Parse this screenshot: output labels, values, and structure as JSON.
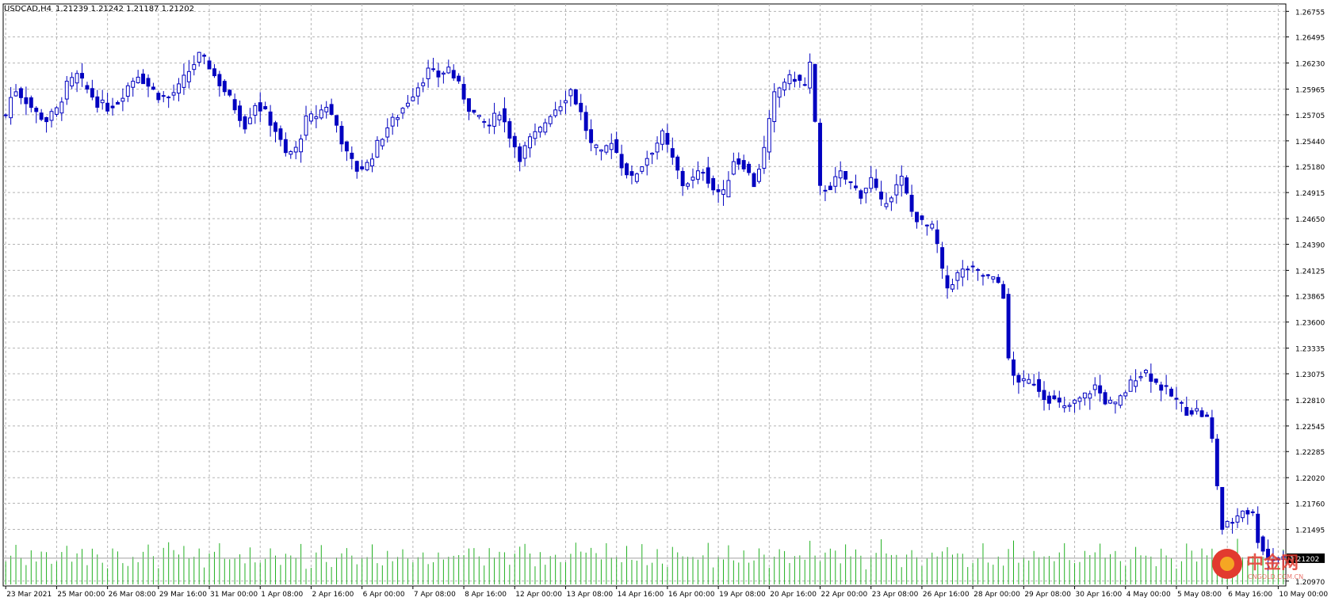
{
  "header": {
    "symbol_label": "USDCAD,H4",
    "ohlc_label": "1.21239 1.21242 1.21187 1.21202"
  },
  "watermark": {
    "brand": "中金网",
    "domain": "CNGOLD.COM.CN"
  },
  "colors": {
    "background": "#ffffff",
    "grid": "#b4b4b4",
    "candle": "#0000c0",
    "volume": "#22b022",
    "axis_text": "#000000",
    "price_marker_bg": "#000000",
    "price_marker_text": "#ffffff",
    "watermark_red": "#e23a2f",
    "watermark_orange": "#f5a623"
  },
  "chart_data": {
    "type": "candlestick",
    "symbol": "USDCAD",
    "timeframe": "H4",
    "title": "USDCAD,H4",
    "grid": true,
    "y_axis_position": "right",
    "ylim": [
      1.2092,
      1.2683
    ],
    "y_ticks": [
      1.26755,
      1.26495,
      1.2623,
      1.25965,
      1.25705,
      1.2544,
      1.2518,
      1.24915,
      1.2465,
      1.2439,
      1.24125,
      1.23865,
      1.236,
      1.23335,
      1.23075,
      1.2281,
      1.22545,
      1.22285,
      1.2202,
      1.2176,
      1.21495,
      1.2097
    ],
    "y_tick_labels": [
      "1.26755",
      "1.26495",
      "1.26230",
      "1.25965",
      "1.25705",
      "1.25440",
      "1.25180",
      "1.24915",
      "1.24650",
      "1.24390",
      "1.24125",
      "1.23865",
      "1.23600",
      "1.23335",
      "1.23075",
      "1.22810",
      "1.22545",
      "1.22285",
      "1.22020",
      "1.21760",
      "1.21495",
      "1.20970"
    ],
    "current_price": 1.21202,
    "current_price_label": "1.21202",
    "x_tick_labels": [
      "23 Mar 2021",
      "25 Mar 00:00",
      "26 Mar 08:00",
      "29 Mar 16:00",
      "31 Mar 00:00",
      "1 Apr 08:00",
      "2 Apr 16:00",
      "6 Apr 00:00",
      "7 Apr 08:00",
      "8 Apr 16:00",
      "12 Apr 00:00",
      "13 Apr 08:00",
      "14 Apr 16:00",
      "16 Apr 00:00",
      "19 Apr 08:00",
      "20 Apr 16:00",
      "22 Apr 00:00",
      "23 Apr 08:00",
      "26 Apr 16:00",
      "28 Apr 00:00",
      "29 Apr 08:00",
      "30 Apr 16:00",
      "4 May 00:00",
      "5 May 08:00",
      "6 May 16:00",
      "10 May 00:00"
    ],
    "x_tick_bar_index": [
      0,
      10,
      20,
      30,
      40,
      50,
      60,
      70,
      80,
      90,
      100,
      110,
      120,
      130,
      140,
      150,
      160,
      170,
      180,
      190,
      200,
      210,
      220,
      230,
      240,
      250
    ],
    "price_path": [
      [
        0,
        1.257
      ],
      [
        1,
        1.2588
      ],
      [
        2,
        1.2596
      ],
      [
        4,
        1.2585
      ],
      [
        6,
        1.2572
      ],
      [
        8,
        1.2565
      ],
      [
        10,
        1.2575
      ],
      [
        12,
        1.26
      ],
      [
        14,
        1.261
      ],
      [
        16,
        1.2596
      ],
      [
        18,
        1.2583
      ],
      [
        20,
        1.2578
      ],
      [
        22,
        1.2584
      ],
      [
        24,
        1.26
      ],
      [
        26,
        1.2612
      ],
      [
        28,
        1.26
      ],
      [
        30,
        1.259
      ],
      [
        32,
        1.2588
      ],
      [
        34,
        1.2598
      ],
      [
        36,
        1.2615
      ],
      [
        38,
        1.263
      ],
      [
        40,
        1.262
      ],
      [
        41,
        1.261
      ],
      [
        43,
        1.2595
      ],
      [
        45,
        1.2578
      ],
      [
        47,
        1.256
      ],
      [
        49,
        1.2582
      ],
      [
        51,
        1.2572
      ],
      [
        53,
        1.2555
      ],
      [
        55,
        1.253
      ],
      [
        57,
        1.2535
      ],
      [
        59,
        1.2565
      ],
      [
        61,
        1.257
      ],
      [
        63,
        1.258
      ],
      [
        65,
        1.256
      ],
      [
        67,
        1.253
      ],
      [
        69,
        1.2515
      ],
      [
        71,
        1.252
      ],
      [
        73,
        1.254
      ],
      [
        75,
        1.2558
      ],
      [
        77,
        1.257
      ],
      [
        79,
        1.2585
      ],
      [
        81,
        1.26
      ],
      [
        83,
        1.2615
      ],
      [
        85,
        1.261
      ],
      [
        87,
        1.2618
      ],
      [
        89,
        1.26
      ],
      [
        91,
        1.2578
      ],
      [
        93,
        1.2565
      ],
      [
        95,
        1.256
      ],
      [
        97,
        1.2575
      ],
      [
        99,
        1.255
      ],
      [
        101,
        1.2528
      ],
      [
        103,
        1.2545
      ],
      [
        105,
        1.2555
      ],
      [
        107,
        1.2572
      ],
      [
        109,
        1.2582
      ],
      [
        111,
        1.2596
      ],
      [
        113,
        1.2572
      ],
      [
        115,
        1.254
      ],
      [
        117,
        1.253
      ],
      [
        119,
        1.2545
      ],
      [
        121,
        1.252
      ],
      [
        123,
        1.2505
      ],
      [
        125,
        1.252
      ],
      [
        127,
        1.2535
      ],
      [
        129,
        1.255
      ],
      [
        131,
        1.2525
      ],
      [
        133,
        1.25
      ],
      [
        135,
        1.2505
      ],
      [
        137,
        1.2515
      ],
      [
        139,
        1.2495
      ],
      [
        141,
        1.249
      ],
      [
        143,
        1.2525
      ],
      [
        145,
        1.252
      ],
      [
        147,
        1.25
      ],
      [
        149,
        1.2535
      ],
      [
        151,
        1.259
      ],
      [
        153,
        1.2605
      ],
      [
        155,
        1.2608
      ],
      [
        157,
        1.26
      ],
      [
        158,
        1.2622
      ],
      [
        159,
        1.256
      ],
      [
        160,
        1.2495
      ],
      [
        162,
        1.2498
      ],
      [
        164,
        1.251
      ],
      [
        166,
        1.25
      ],
      [
        168,
        1.249
      ],
      [
        170,
        1.2505
      ],
      [
        172,
        1.248
      ],
      [
        174,
        1.249
      ],
      [
        176,
        1.2505
      ],
      [
        178,
        1.2472
      ],
      [
        180,
        1.246
      ],
      [
        182,
        1.2455
      ],
      [
        183,
        1.2438
      ],
      [
        184,
        1.241
      ],
      [
        185,
        1.2395
      ],
      [
        187,
        1.2408
      ],
      [
        189,
        1.2415
      ],
      [
        191,
        1.241
      ],
      [
        193,
        1.2405
      ],
      [
        195,
        1.24
      ],
      [
        196,
        1.2388
      ],
      [
        197,
        1.232
      ],
      [
        198,
        1.2305
      ],
      [
        200,
        1.2298
      ],
      [
        202,
        1.23
      ],
      [
        204,
        1.2285
      ],
      [
        206,
        1.228
      ],
      [
        208,
        1.2272
      ],
      [
        210,
        1.2278
      ],
      [
        212,
        1.2285
      ],
      [
        214,
        1.2295
      ],
      [
        216,
        1.228
      ],
      [
        218,
        1.2275
      ],
      [
        220,
        1.229
      ],
      [
        222,
        1.2305
      ],
      [
        224,
        1.231
      ],
      [
        226,
        1.2298
      ],
      [
        228,
        1.229
      ],
      [
        230,
        1.228
      ],
      [
        232,
        1.227
      ],
      [
        234,
        1.227
      ],
      [
        236,
        1.2262
      ],
      [
        237,
        1.224
      ],
      [
        238,
        1.2195
      ],
      [
        239,
        1.215
      ],
      [
        241,
        1.2158
      ],
      [
        243,
        1.217
      ],
      [
        245,
        1.2165
      ],
      [
        246,
        1.214
      ],
      [
        248,
        1.212
      ]
    ],
    "volume_levels": [
      0.3,
      0.5,
      0.8,
      0.4,
      0.35,
      0.6,
      0.3,
      0.45,
      0.7,
      0.25
    ]
  }
}
